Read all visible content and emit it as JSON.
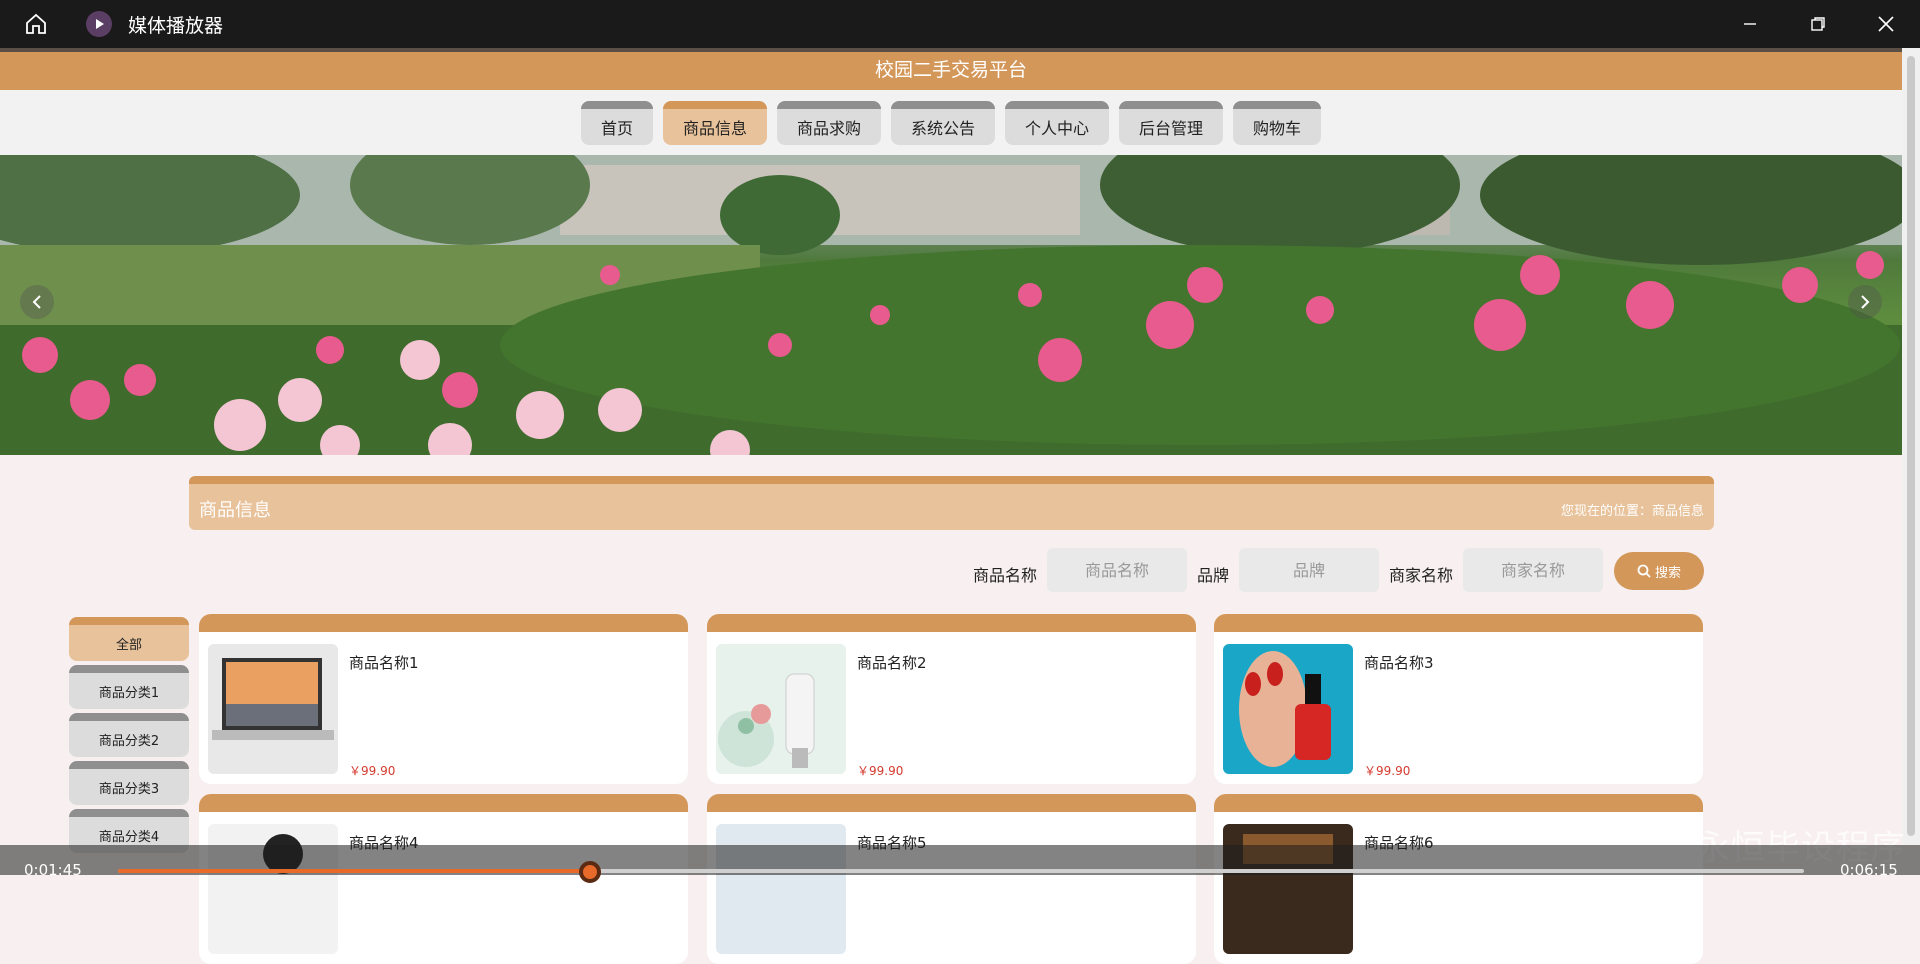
{
  "player": {
    "title": "媒体播放器",
    "current_time": "0:01:45",
    "total_time": "0:06:15",
    "progress": 0.28,
    "watermark": "CSDN @永恒毕设程序"
  },
  "site": {
    "title": "校园二手交易平台",
    "nav": [
      "首页",
      "商品信息",
      "商品求购",
      "系统公告",
      "个人中心",
      "后台管理",
      "购物车"
    ],
    "active_nav": "商品信息"
  },
  "section": {
    "title": "商品信息",
    "breadcrumb": "您现在的位置：商品信息"
  },
  "search": {
    "name_label": "商品名称",
    "name_placeholder": "商品名称",
    "brand_label": "品牌",
    "brand_placeholder": "品牌",
    "merchant_label": "商家名称",
    "merchant_placeholder": "商家名称",
    "button": "搜索"
  },
  "categories": [
    "全部",
    "商品分类1",
    "商品分类2",
    "商品分类3",
    "商品分类4"
  ],
  "products": [
    {
      "name": "商品名称1",
      "price": "￥99.90"
    },
    {
      "name": "商品名称2",
      "price": "￥99.90"
    },
    {
      "name": "商品名称3",
      "price": "￥99.90"
    },
    {
      "name": "商品名称4",
      "price": ""
    },
    {
      "name": "商品名称5",
      "price": ""
    },
    {
      "name": "商品名称6",
      "price": ""
    }
  ],
  "colors": {
    "accent": "#d4975a",
    "accent_light": "#e8c29a",
    "price": "#d43a2f",
    "progress": "#e86a2a"
  }
}
